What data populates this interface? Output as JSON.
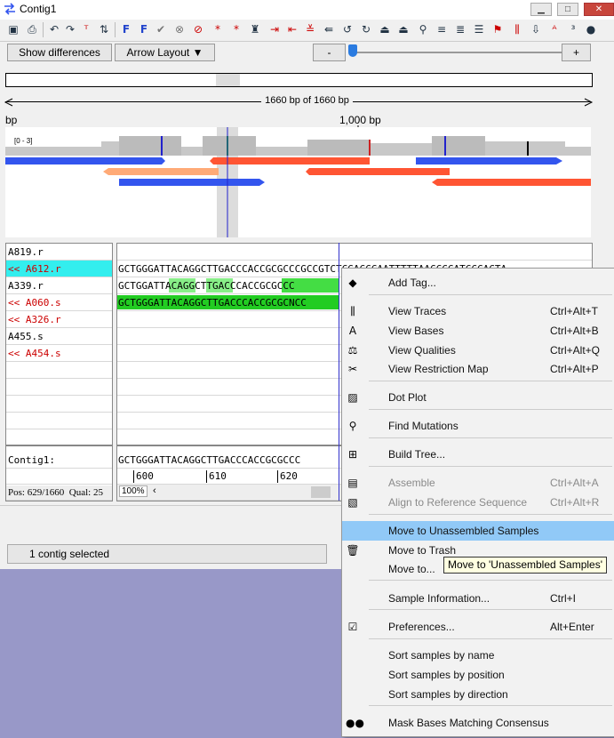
{
  "window": {
    "title": "Contig1",
    "min_glyph": "▁",
    "max_glyph": "□",
    "close_glyph": "✕"
  },
  "buttons": {
    "show_differences": "Show differences",
    "arrow_layout": "Arrow Layout ▼",
    "zoom_out": "-",
    "zoom_in": "+"
  },
  "ruler": {
    "length_label": "1660 bp of 1660 bp",
    "left_label": "bp",
    "mid_label": "1,000 bp",
    "range_label": "[0 - 3]"
  },
  "samples": [
    {
      "name": "A819.r",
      "color": "#000000",
      "selected": false
    },
    {
      "name": "<< A612.r",
      "color": "#cc0000",
      "selected": true
    },
    {
      "name": "A339.r",
      "color": "#000000",
      "selected": false
    },
    {
      "name": "<< A060.s",
      "color": "#cc0000",
      "selected": false
    },
    {
      "name": "<< A326.r",
      "color": "#cc0000",
      "selected": false
    },
    {
      "name": "A455.s",
      "color": "#000000",
      "selected": false
    },
    {
      "name": "<< A454.s",
      "color": "#cc0000",
      "selected": false
    }
  ],
  "sequences": {
    "a612": "GCTGGGATTACAGGCTTGACCCACCGCGCCCGCCGTCTCGACCCAATTTTTAACCCCATCCCACTA",
    "a339": "GCTGGATTACAGGCTTGACCCACCGCGCCC",
    "a060": "GCTGGGATTACAGGCTTGACCCACCGCGCNCC",
    "contig": "GCTGGGATTACAGGCTTGACCCACCGCGCCC"
  },
  "contig_label": "Contig1:",
  "positions": [
    "600",
    "610",
    "620"
  ],
  "status": {
    "pos": "Pos: 629/1660",
    "qual": "Qual: 25",
    "zoom": "100%",
    "selection": "1 contig selected"
  },
  "menu": [
    {
      "icon": "tag-icon",
      "glyph": "◆",
      "label": "Add Tag...",
      "shortcut": "",
      "disabled": false,
      "highlight": false
    },
    {
      "icon": "traces-icon",
      "glyph": "⫼",
      "label": "View Traces",
      "shortcut": "Ctrl+Alt+T",
      "disabled": false,
      "highlight": false
    },
    {
      "icon": "bases-icon",
      "glyph": "A",
      "label": "View Bases",
      "shortcut": "Ctrl+Alt+B",
      "disabled": false,
      "highlight": false
    },
    {
      "icon": "qualities-icon",
      "glyph": "⚖",
      "label": "View Qualities",
      "shortcut": "Ctrl+Alt+Q",
      "disabled": false,
      "highlight": false
    },
    {
      "icon": "restriction-map-icon",
      "glyph": "✂",
      "label": "View Restriction Map",
      "shortcut": "Ctrl+Alt+P",
      "disabled": false,
      "highlight": false
    },
    {
      "icon": "dot-plot-icon",
      "glyph": "▨",
      "label": "Dot Plot",
      "shortcut": "",
      "disabled": false,
      "highlight": false
    },
    {
      "icon": "find-mutations-icon",
      "glyph": "⚲",
      "label": "Find Mutations",
      "shortcut": "",
      "disabled": false,
      "highlight": false
    },
    {
      "icon": "build-tree-icon",
      "glyph": "⊞",
      "label": "Build Tree...",
      "shortcut": "",
      "disabled": false,
      "highlight": false
    },
    {
      "icon": "assemble-icon",
      "glyph": "▤",
      "label": "Assemble",
      "shortcut": "Ctrl+Alt+A",
      "disabled": true,
      "highlight": false
    },
    {
      "icon": "align-reference-icon",
      "glyph": "▧",
      "label": "Align to Reference Sequence",
      "shortcut": "Ctrl+Alt+R",
      "disabled": true,
      "highlight": false
    },
    {
      "icon": "",
      "glyph": "",
      "label": "Move to Unassembled Samples",
      "shortcut": "",
      "disabled": false,
      "highlight": true
    },
    {
      "icon": "trash-icon",
      "glyph": "🗑",
      "label": "Move to Trash",
      "shortcut": "",
      "disabled": false,
      "highlight": false
    },
    {
      "icon": "",
      "glyph": "",
      "label": "Move to...",
      "shortcut": "",
      "disabled": false,
      "highlight": false
    },
    {
      "icon": "",
      "glyph": "",
      "label": "Sample Information...",
      "shortcut": "Ctrl+I",
      "disabled": false,
      "highlight": false
    },
    {
      "icon": "preferences-icon",
      "glyph": "☑",
      "label": "Preferences...",
      "shortcut": "Alt+Enter",
      "disabled": false,
      "highlight": false
    },
    {
      "icon": "",
      "glyph": "",
      "label": "Sort samples by name",
      "shortcut": "",
      "disabled": false,
      "highlight": false
    },
    {
      "icon": "",
      "glyph": "",
      "label": "Sort samples by position",
      "shortcut": "",
      "disabled": false,
      "highlight": false
    },
    {
      "icon": "",
      "glyph": "",
      "label": "Sort samples by direction",
      "shortcut": "",
      "disabled": false,
      "highlight": false
    },
    {
      "icon": "mask-icon",
      "glyph": "●●",
      "label": "Mask Bases Matching Consensus",
      "shortcut": "",
      "disabled": false,
      "highlight": false
    }
  ],
  "tooltip": "Move to 'Unassembled Samples'",
  "colors": {
    "selected_row": "#33eeee",
    "match_green": "#22cc22",
    "highlight": "#91c9f7",
    "read_blue": "#3355ee",
    "read_orange": "#ff5533"
  }
}
